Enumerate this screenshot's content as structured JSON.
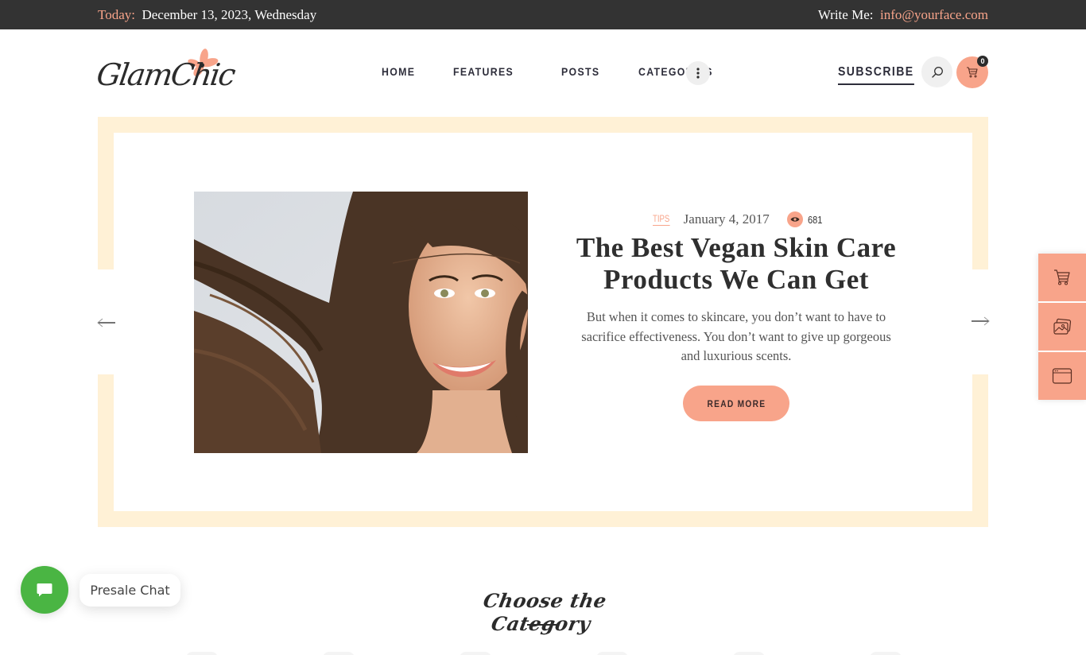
{
  "topbar": {
    "today_label": "Today:",
    "date": "December 13, 2023, Wednesday",
    "write_label": "Write Me:",
    "email": "info@yourface.com"
  },
  "header": {
    "logo_text": "GlamChic",
    "nav": [
      {
        "label": "HOME"
      },
      {
        "label": "FEATURES"
      },
      {
        "label": "POSTS"
      },
      {
        "label": "CATEGORIES"
      }
    ],
    "more_icon": "vertical-dots-icon",
    "subscribe_label": "SUBSCRIBE",
    "search_icon": "search-icon",
    "cart_icon": "cart-icon",
    "cart_count": "0"
  },
  "hero": {
    "image_alt": "Smiling woman with flowing brown hair",
    "tag": "TIPS",
    "date": "January 4, 2017",
    "views_icon": "eye-icon",
    "views": "681",
    "title": "The Best Vegan Skin Care Products We Can Get",
    "excerpt": "But when it comes to skincare, you don’t want to have to sacrifice effectiveness. You don’t want to give up gorgeous and luxurious scents.",
    "read_more_label": "READ MORE",
    "prev_icon": "arrow-left-icon",
    "next_icon": "arrow-right-icon"
  },
  "side_panel": {
    "items": [
      {
        "icon": "cart-icon"
      },
      {
        "icon": "images-icon"
      },
      {
        "icon": "browser-window-icon"
      }
    ]
  },
  "chat": {
    "icon": "chat-bubble-icon",
    "label": "Presale Chat"
  },
  "categories": {
    "title": "Choose the Category"
  },
  "colors": {
    "accent": "#f8a48a",
    "topbar_bg": "#333333",
    "frame": "#fff1d6",
    "chat_green": "#4ab543",
    "text_dark": "#2d2d3a"
  }
}
